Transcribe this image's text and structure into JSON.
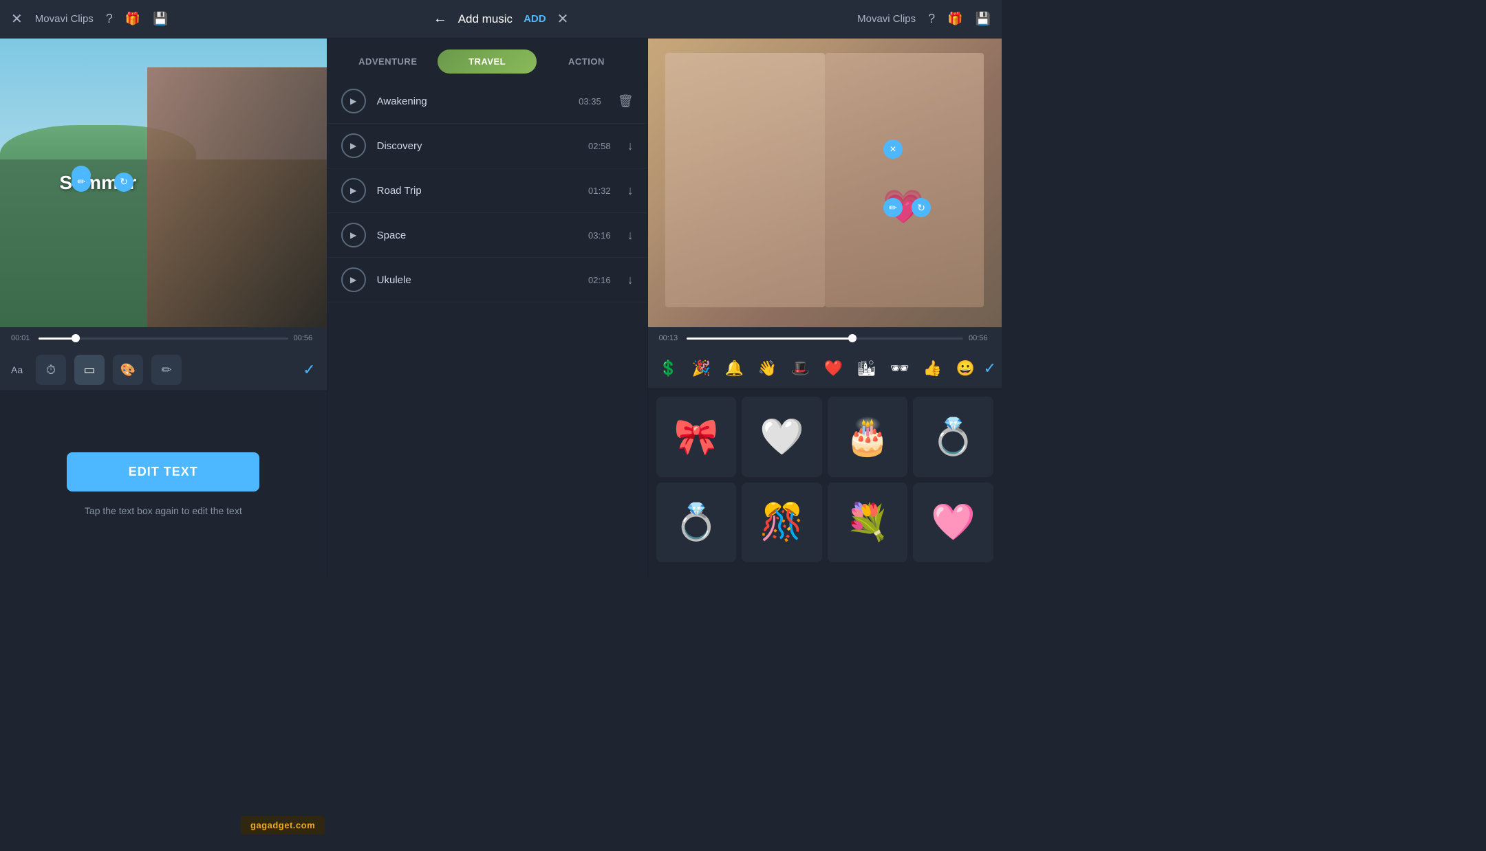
{
  "topbar": {
    "left": {
      "close_label": "✕",
      "app_title": "Movavi Clips",
      "help_icon": "?",
      "gift_icon": "🎁",
      "save_icon": "💾"
    },
    "center": {
      "back_icon": "←",
      "title": "Add music",
      "add_label": "ADD",
      "close_label": "✕"
    },
    "right": {
      "app_title": "Movavi Clips",
      "help_icon": "?",
      "gift_icon": "🎁",
      "save_icon": "💾"
    }
  },
  "music": {
    "tabs": [
      {
        "id": "adventure",
        "label": "ADVENTURE",
        "active": false
      },
      {
        "id": "travel",
        "label": "TRAVEL",
        "active": true
      },
      {
        "id": "action",
        "label": "ACTION",
        "active": false
      }
    ],
    "tracks": [
      {
        "title": "Awakening",
        "duration": "03:35",
        "downloaded": true
      },
      {
        "title": "Discovery",
        "duration": "02:58",
        "downloaded": false
      },
      {
        "title": "Road Trip",
        "duration": "01:32",
        "downloaded": false
      },
      {
        "title": "Space",
        "duration": "03:16",
        "downloaded": false
      },
      {
        "title": "Ukulele",
        "duration": "02:16",
        "downloaded": false
      }
    ]
  },
  "left_panel": {
    "text_overlay": "Summer",
    "timeline_start": "00:01",
    "timeline_end": "00:56",
    "toolbar_label": "Aa",
    "edit_text_btn": "EDIT TEXT",
    "edit_text_hint": "Tap the text box again to edit the text"
  },
  "right_panel": {
    "timeline_start": "00:13",
    "timeline_end": "00:56",
    "stickers": [
      "🎀",
      "🤍",
      "🎂",
      "💍",
      "💍",
      "🎊",
      "💐",
      "🩷"
    ]
  },
  "watermark": {
    "text": "gagadget.com"
  }
}
